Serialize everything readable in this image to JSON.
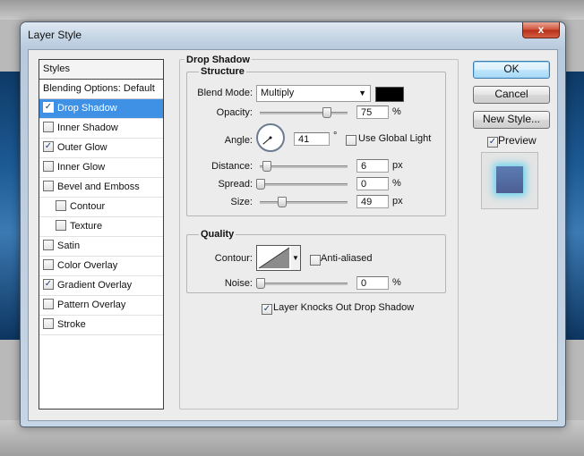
{
  "window": {
    "title": "Layer Style",
    "close_label": "x"
  },
  "styles_panel": {
    "header": "Styles",
    "blending_label": "Blending Options: Default",
    "items": [
      {
        "label": "Drop Shadow",
        "checked": true,
        "selected": true,
        "sub": false
      },
      {
        "label": "Inner Shadow",
        "checked": false,
        "selected": false,
        "sub": false
      },
      {
        "label": "Outer Glow",
        "checked": true,
        "selected": false,
        "sub": false
      },
      {
        "label": "Inner Glow",
        "checked": false,
        "selected": false,
        "sub": false
      },
      {
        "label": "Bevel and Emboss",
        "checked": false,
        "selected": false,
        "sub": false
      },
      {
        "label": "Contour",
        "checked": false,
        "selected": false,
        "sub": true
      },
      {
        "label": "Texture",
        "checked": false,
        "selected": false,
        "sub": true
      },
      {
        "label": "Satin",
        "checked": false,
        "selected": false,
        "sub": false
      },
      {
        "label": "Color Overlay",
        "checked": false,
        "selected": false,
        "sub": false
      },
      {
        "label": "Gradient Overlay",
        "checked": true,
        "selected": false,
        "sub": false
      },
      {
        "label": "Pattern Overlay",
        "checked": false,
        "selected": false,
        "sub": false
      },
      {
        "label": "Stroke",
        "checked": false,
        "selected": false,
        "sub": false
      }
    ]
  },
  "drop_shadow": {
    "section_title": "Drop Shadow",
    "structure": {
      "title": "Structure",
      "blend_mode_label": "Blend Mode:",
      "blend_mode_value": "Multiply",
      "shadow_color": "#000000",
      "opacity_label": "Opacity:",
      "opacity_value": "75",
      "opacity_unit": "%",
      "opacity_fraction": 0.75,
      "angle_label": "Angle:",
      "angle_value": "41",
      "angle_unit": "°",
      "use_global_light_label": "Use Global Light",
      "use_global_light_checked": false,
      "distance_label": "Distance:",
      "distance_value": "6",
      "distance_unit": "px",
      "distance_fraction": 0.03,
      "spread_label": "Spread:",
      "spread_value": "0",
      "spread_unit": "%",
      "spread_fraction": 0.0,
      "size_label": "Size:",
      "size_value": "49",
      "size_unit": "px",
      "size_fraction": 0.2
    },
    "quality": {
      "title": "Quality",
      "contour_label": "Contour:",
      "anti_aliased_label": "Anti-aliased",
      "anti_aliased_checked": false,
      "noise_label": "Noise:",
      "noise_value": "0",
      "noise_unit": "%",
      "noise_fraction": 0.0
    },
    "knocks_out_label": "Layer Knocks Out Drop Shadow",
    "knocks_out_checked": true
  },
  "buttons": {
    "ok": "OK",
    "cancel": "Cancel",
    "new_style": "New Style...",
    "preview_label": "Preview",
    "preview_checked": true
  },
  "colors": {
    "selection": "#3f91e6",
    "preview_glow": "#67d4f0",
    "preview_fill": "#56699f"
  }
}
